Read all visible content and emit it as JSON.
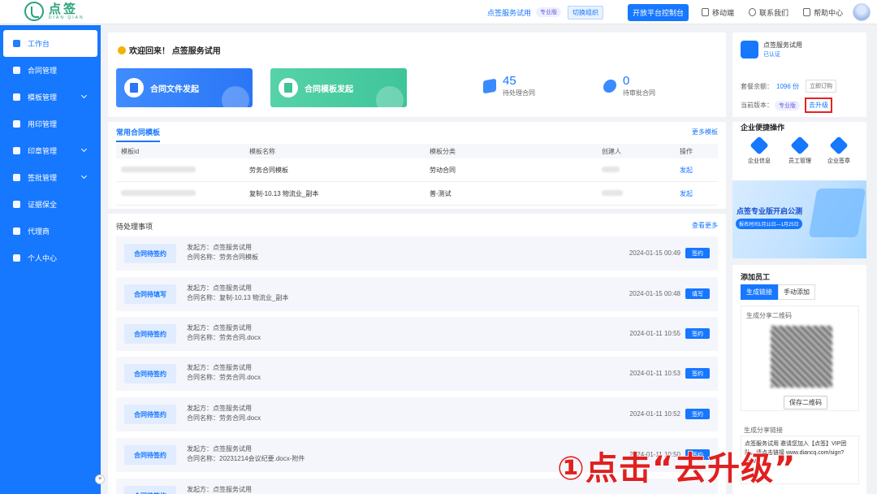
{
  "topbar": {
    "logo_cn": "点签",
    "logo_en": "DIAN QIAN",
    "company": "点签服务试用",
    "company_badge": "专业版",
    "switch_label": "切换组织",
    "open_label": "开放平台控制台",
    "mobile_label": "移动端",
    "contact_label": "联系我们",
    "help_label": "帮助中心"
  },
  "sidebar": {
    "items": [
      {
        "label": "工作台"
      },
      {
        "label": "合同管理"
      },
      {
        "label": "模板管理"
      },
      {
        "label": "用印管理"
      },
      {
        "label": "印章管理"
      },
      {
        "label": "签批管理"
      },
      {
        "label": "证据保全"
      },
      {
        "label": "代理商"
      },
      {
        "label": "个人中心"
      }
    ]
  },
  "welcome": {
    "title": "欢迎回来！ 点签服务试用",
    "btn_file": "合同文件发起",
    "btn_template": "合同模板发起",
    "pending_count": "45",
    "pending_label": "待处理合同",
    "expiring_count": "0",
    "expiring_label": "待审批合同"
  },
  "templates": {
    "tab": "常用合同模板",
    "more": "更多模板",
    "headers": [
      "模板id",
      "模板名称",
      "模板分类",
      "创建人",
      "操作"
    ],
    "rows": [
      {
        "name": "劳务合同模板",
        "category": "劳动合同",
        "action": "发起"
      },
      {
        "name": "复制-10.13 物流业_副本",
        "category": "普-测试",
        "action": "发起"
      }
    ]
  },
  "todo": {
    "title": "待处理事项",
    "more": "查看更多",
    "items": [
      {
        "tag": "合同待签约",
        "sender": "发起方：点签服务试用",
        "contract": "合同名称：劳务合同模板",
        "time": "2024-01-15 00:49",
        "action": "签约"
      },
      {
        "tag": "合同待填写",
        "sender": "发起方：点签服务试用",
        "contract": "合同名称：复制-10.13 物流业_副本",
        "time": "2024-01-15 00:48",
        "action": "填写"
      },
      {
        "tag": "合同待签约",
        "sender": "发起方：点签服务试用",
        "contract": "合同名称：劳务合同.docx",
        "time": "2024-01-11 10:55",
        "action": "签约"
      },
      {
        "tag": "合同待签约",
        "sender": "发起方：点签服务试用",
        "contract": "合同名称：劳务合同.docx",
        "time": "2024-01-11 10:53",
        "action": "签约"
      },
      {
        "tag": "合同待签约",
        "sender": "发起方：点签服务试用",
        "contract": "合同名称：劳务合同.docx",
        "time": "2024-01-11 10:52",
        "action": "签约"
      },
      {
        "tag": "合同待签约",
        "sender": "发起方：点签服务试用",
        "contract": "合同名称：20231214会议纪要.docx-附件",
        "time": "2024-01-11 10:50",
        "action": "签约"
      },
      {
        "tag": "合同待签约",
        "sender": "发起方：点签服务试用",
        "contract": "",
        "time": "",
        "action": ""
      }
    ]
  },
  "profile": {
    "org_name": "点签服务试用",
    "verified": "已认证",
    "balance_label": "套餐余额：",
    "balance_value": "1096 份",
    "buy_label": "立即订购",
    "version_label": "当前版本：",
    "version_badge": "专业版",
    "upgrade_label": "去升级"
  },
  "quick": {
    "title": "企业便捷操作",
    "items": [
      {
        "label": "企业信息"
      },
      {
        "label": "员工管理"
      },
      {
        "label": "企业签章"
      }
    ]
  },
  "banner": {
    "title": "点签专业版开启公测",
    "date": "报名时间1月11日—1月25日"
  },
  "addstaff": {
    "title": "添加员工",
    "tab_link": "生成链接",
    "tab_manual": "手动添加",
    "qr_label": "生成分享二维码",
    "save_label": "保存二维码",
    "link_label": "生成分享链接",
    "link_text": "点签服务试用 邀请您加入【点签】VIP团队，请点击链接 www.diancq.com/sign?k=lMb"
  },
  "annotation": "①点击“去升级”",
  "colors": {
    "accent": "#1677ff",
    "green": "#3fc49a",
    "alert": "#e02020"
  }
}
